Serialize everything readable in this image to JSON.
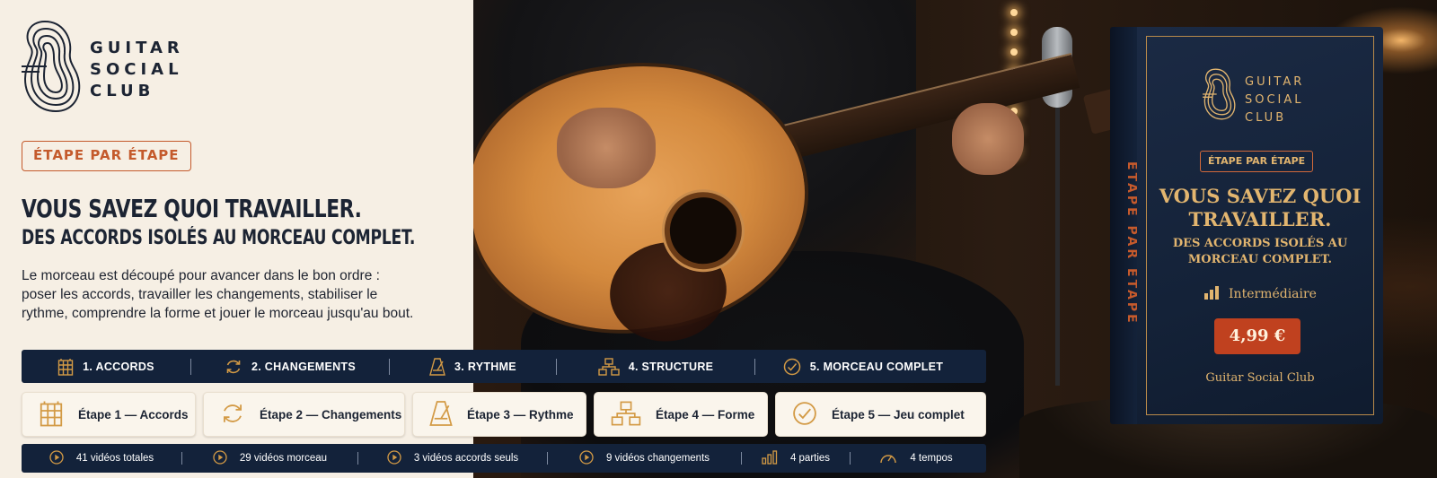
{
  "brand": {
    "line1": "GUITAR",
    "line2": "SOCIAL",
    "line3": "CLUB"
  },
  "badge": "ÉTAPE PAR ÉTAPE",
  "headline": "VOUS SAVEZ QUOI TRAVAILLER.",
  "subhead": "DES ACCORDS ISOLÉS AU MORCEAU COMPLET.",
  "body_text": "Le morceau est découpé pour avancer dans le bon ordre : poser les accords, travailler les changements, stabiliser le rythme, comprendre la forme et jouer le morceau jusqu'au bout.",
  "steps_bar": [
    {
      "label": "1. ACCORDS",
      "icon": "grid-icon"
    },
    {
      "label": "2. CHANGEMENTS",
      "icon": "refresh-icon"
    },
    {
      "label": "3. RYTHME",
      "icon": "metronome-icon"
    },
    {
      "label": "4. STRUCTURE",
      "icon": "hierarchy-icon"
    },
    {
      "label": "5. MORCEAU COMPLET",
      "icon": "check-circle-icon"
    }
  ],
  "cards": [
    {
      "label": "Étape 1 — Accords",
      "icon": "grid-icon"
    },
    {
      "label": "Étape 2 — Changements",
      "icon": "refresh-icon"
    },
    {
      "label": "Étape 3 — Rythme",
      "icon": "metronome-icon"
    },
    {
      "label": "Étape 4 — Forme",
      "icon": "hierarchy-icon"
    },
    {
      "label": "Étape 5 — Jeu complet",
      "icon": "check-circle-icon"
    }
  ],
  "stats": [
    {
      "label": "41 vidéos totales",
      "icon": "play-circle-icon"
    },
    {
      "label": "29 vidéos morceau",
      "icon": "play-circle-icon"
    },
    {
      "label": "3 vidéos accords seuls",
      "icon": "play-circle-icon"
    },
    {
      "label": "9 vidéos changements",
      "icon": "play-circle-icon"
    },
    {
      "label": "4 parties",
      "icon": "bars-icon"
    },
    {
      "label": "4 tempos",
      "icon": "gauge-icon"
    }
  ],
  "product_box": {
    "spine": "ÉTAPE PAR ÉTAPE",
    "brand_line1": "GUITAR",
    "brand_line2": "SOCIAL",
    "brand_line3": "CLUB",
    "badge": "ÉTAPE PAR ÉTAPE",
    "headline_line1": "VOUS SAVEZ QUOI",
    "headline_line2": "TRAVAILLER.",
    "sub_line1": "DES ACCORDS ISOLÉS AU",
    "sub_line2": "MORCEAU COMPLET.",
    "level": "Intermédiaire",
    "price": "4,99 €",
    "footer": "Guitar Social Club"
  },
  "colors": {
    "navy": "#13223a",
    "accent_orange": "#c45a2c",
    "gold": "#e2b56f",
    "cream": "#f6efe4"
  }
}
